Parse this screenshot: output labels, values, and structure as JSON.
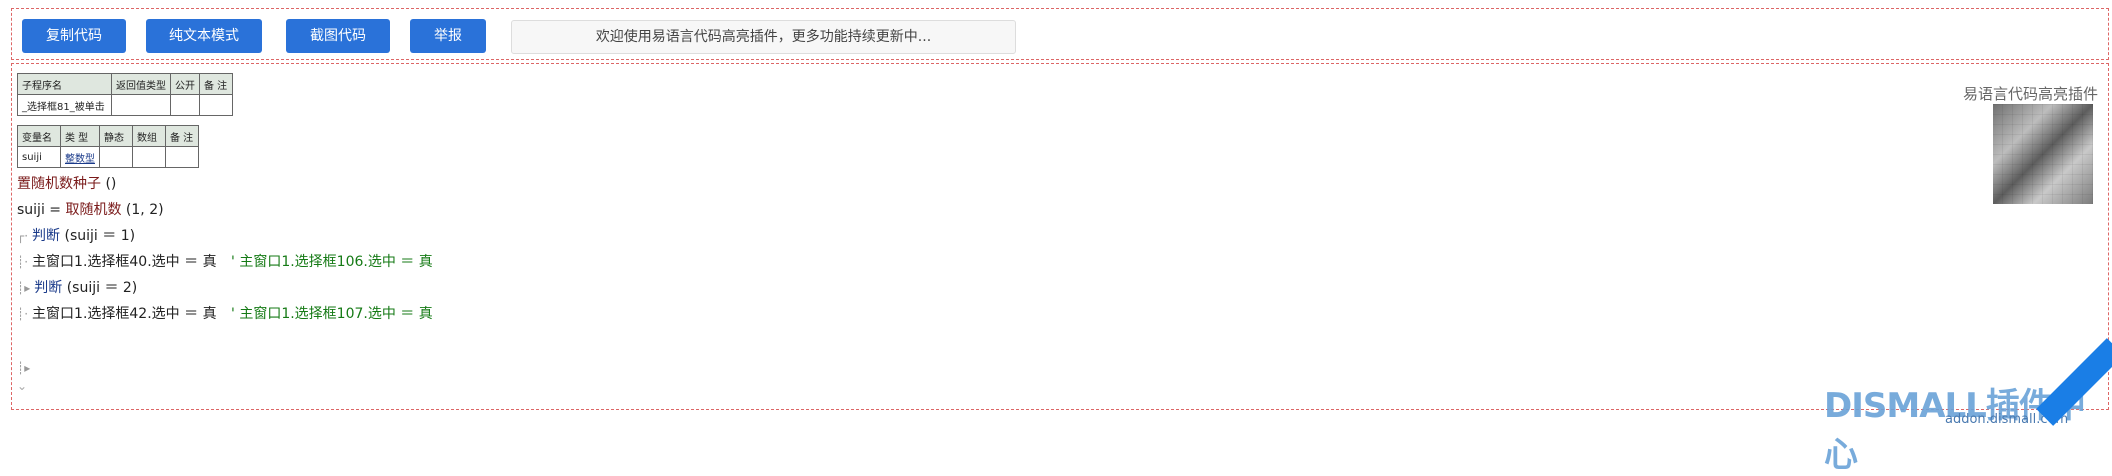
{
  "toolbar": {
    "copy_label": "复制代码",
    "plain_label": "纯文本模式",
    "screenshot_label": "截图代码",
    "report_label": "举报",
    "notice": "欢迎使用易语言代码高亮插件，更多功能持续更新中..."
  },
  "sub_table": {
    "headers": [
      "子程序名",
      "返回值类型",
      "公开",
      "备 注"
    ],
    "row": [
      "_选择框81_被单击",
      "",
      "",
      ""
    ]
  },
  "var_table": {
    "headers": [
      "变量名",
      "类 型",
      "静态",
      "数组",
      "备 注"
    ],
    "row": [
      "suiji",
      "整数型",
      "",
      "",
      ""
    ]
  },
  "code": {
    "l1_fn": "置随机数种子",
    "l1_rest": " ()",
    "l2_var": "suiji",
    "l2_eq": " = ",
    "l2_fn": "取随机数",
    "l2_rest": " (1, 2)",
    "l3_kw": "判断",
    "l3_rest": " (suiji ＝ 1)",
    "l4_code": "主窗口1.选择框40.选中 ＝ 真",
    "l4_comment": "' 主窗口1.选择框106.选中 ＝ 真",
    "l5_kw": "判断",
    "l5_rest": " (suiji ＝ 2)",
    "l6_code": "主窗口1.选择框42.选中 ＝ 真",
    "l6_comment": "' 主窗口1.选择框107.选中 ＝ 真"
  },
  "brand": "易语言代码高亮插件",
  "watermark": "DISMALL插件中心",
  "watermark_url": "addon.dismall.com",
  "colors": {
    "button": "#2a72d9",
    "function": "#7a1a1a",
    "keyword": "#1a3a8a",
    "comment": "#157a15"
  }
}
